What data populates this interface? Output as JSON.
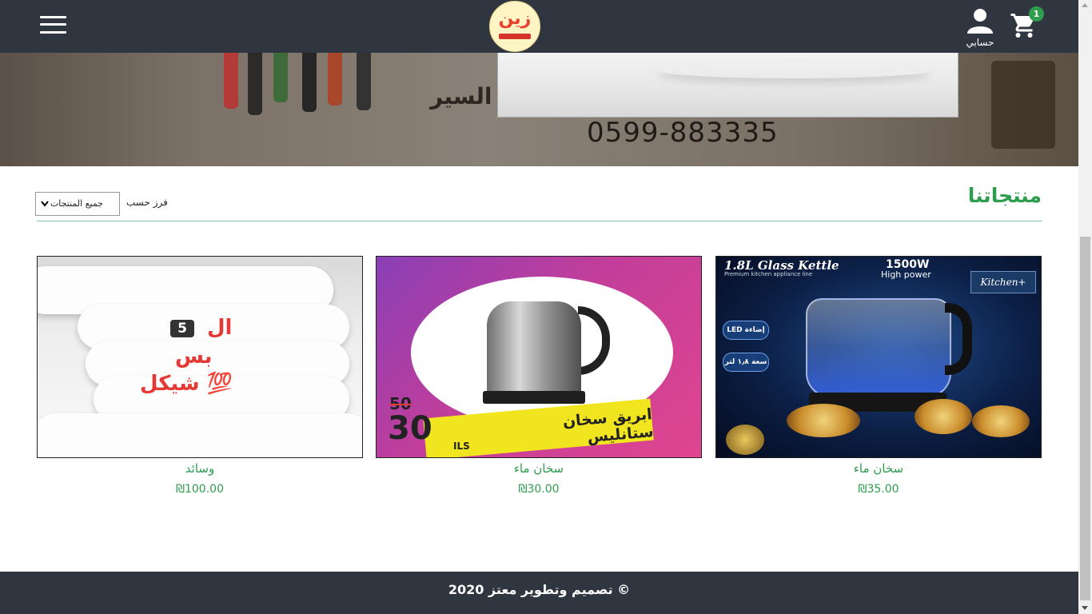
{
  "header": {
    "logo_text": "زين",
    "account_label": "حسابي",
    "cart_count": "1",
    "icons": [
      "hamburger-menu-icon",
      "user-icon",
      "shopping-cart-icon"
    ]
  },
  "banner": {
    "store_text": "السير",
    "phone": "0599-883335"
  },
  "section": {
    "title": "منتجاتنا",
    "sort_label": "فرز حسب",
    "sort_value": "جميع المنتجات"
  },
  "products": [
    {
      "name": "سخان ماء",
      "price": "₪35.00",
      "image": {
        "title": "1.8L Glass Kettle",
        "power": "1500W",
        "power_sub": "High power",
        "tagline": "Premium kitchen appliance line",
        "brand": "Kitchen+",
        "badges": [
          "إضاءة LED",
          "سعة ١٫٨ لتر"
        ]
      }
    },
    {
      "name": "سخان ماء",
      "price": "₪30.00",
      "image": {
        "band_text_1": "ابريق سخان",
        "band_text_2": "ستانليس",
        "old_price": "50",
        "new_price": "30",
        "currency": "ILS"
      }
    },
    {
      "name": "وسائد",
      "price": "₪100.00",
      "image": {
        "line1": "ال",
        "number": "5",
        "line2": "بس",
        "line3": "💯 شيكل"
      }
    }
  ],
  "footer": {
    "copyright": "© تصميم وتطوير معتز 2020"
  },
  "colors": {
    "header_bg": "#2f3640",
    "accent_green": "#2e9d4e",
    "footer_bg": "#2f3640"
  }
}
